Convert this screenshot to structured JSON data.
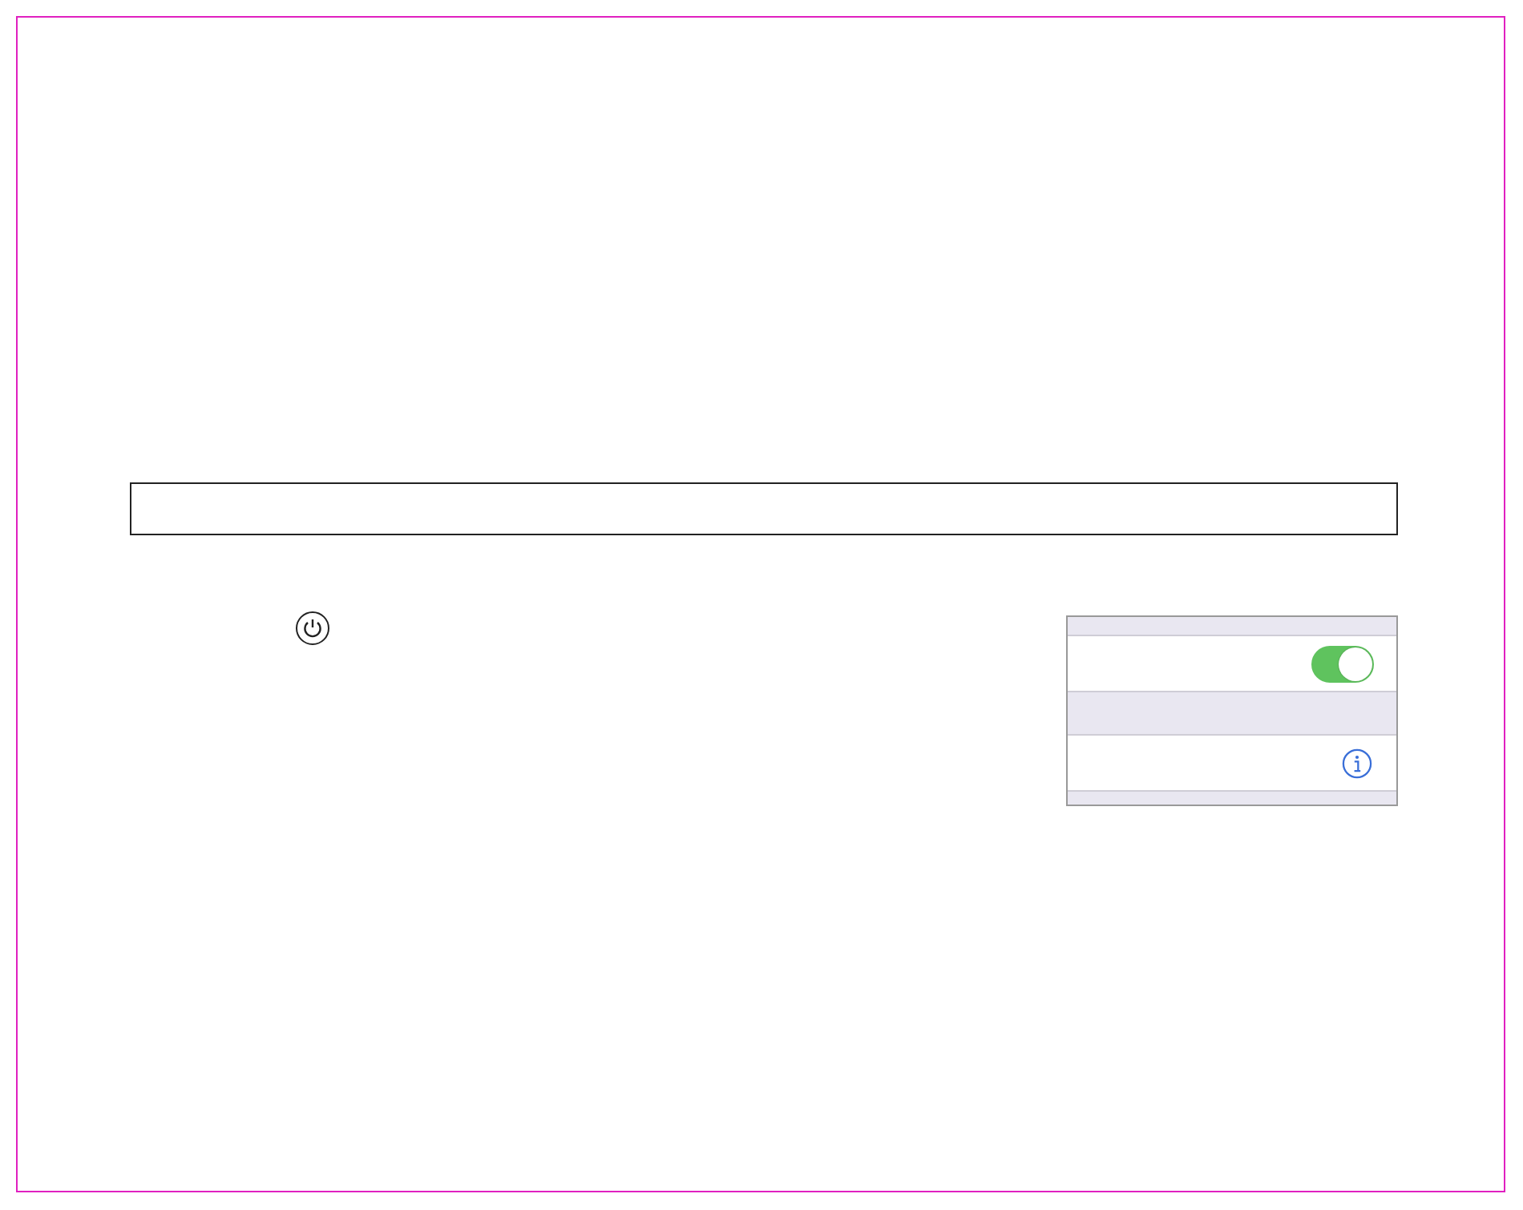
{
  "settings_panel": {
    "rows": [
      {
        "kind": "toggle",
        "on": true
      },
      {
        "kind": "info"
      }
    ]
  }
}
